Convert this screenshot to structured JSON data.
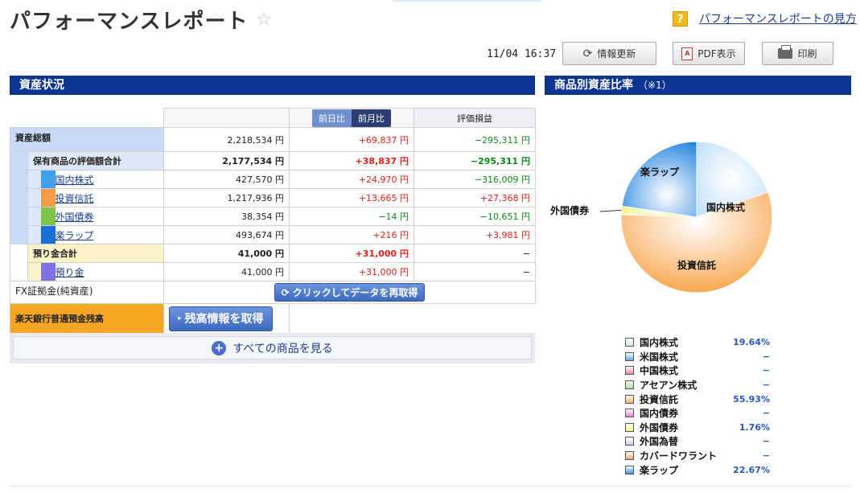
{
  "title": "パフォーマンスレポート",
  "help_link": "パフォーマンスレポートの見方",
  "toolbar": {
    "timestamp": "11/04 16:37",
    "refresh": "情報更新",
    "pdf": "PDF表示",
    "print": "印刷"
  },
  "section_assets": "資産状況",
  "section_ratio": "商品別資産比率",
  "section_ratio_note": "（※1）",
  "headers": {
    "prev_day": "前日比",
    "prev_month": "前月比",
    "pl": "評価損益"
  },
  "total": {
    "label": "資産総額",
    "value": "2,218,534 円",
    "change": "+69,837 円",
    "pl": "−295,311 円"
  },
  "holdings": {
    "label": "保有商品の評価額合計",
    "value": "2,177,534 円",
    "change": "+38,837 円",
    "pl": "−295,311 円"
  },
  "items": [
    {
      "name": "国内株式",
      "value": "427,570 円",
      "change": "+24,970 円",
      "pl": "−316,009 円",
      "color": "#3fa0ee",
      "change_color": "red",
      "pl_color": "green"
    },
    {
      "name": "投資信託",
      "value": "1,217,936 円",
      "change": "+13,665 円",
      "pl": "+27,368 円",
      "color": "#f79a45",
      "change_color": "red",
      "pl_color": "red"
    },
    {
      "name": "外国債券",
      "value": "38,354 円",
      "change": "−14 円",
      "pl": "−10,651 円",
      "color": "#7ec34a",
      "change_color": "green",
      "pl_color": "green"
    },
    {
      "name": "楽ラップ",
      "value": "493,674 円",
      "change": "+216 円",
      "pl": "+3,981 円",
      "color": "#1a6fd6",
      "change_color": "red",
      "pl_color": "red"
    }
  ],
  "deposits_total": {
    "label": "預り金合計",
    "value": "41,000 円",
    "change": "+31,000 円",
    "pl": "−"
  },
  "deposit": {
    "name": "預り金",
    "value": "41,000 円",
    "change": "+31,000 円",
    "pl": "−",
    "color": "#7e72e4"
  },
  "fx": {
    "label": "FX証拠金(純資産)",
    "button": "クリックしてデータを再取得"
  },
  "bank": {
    "label": "楽天銀行普通預金残高",
    "button": "残高情報を取得"
  },
  "see_all": "すべての商品を見る",
  "chart_data": {
    "type": "pie",
    "slices": [
      {
        "name": "国内株式",
        "value": 19.64,
        "color": "#cfe8fb"
      },
      {
        "name": "投資信託",
        "value": 55.93,
        "color": "#f8b060"
      },
      {
        "name": "外国債券",
        "value": 1.76,
        "color": "#f4f28a"
      },
      {
        "name": "楽ラップ",
        "value": 22.67,
        "color": "#3a92e0"
      }
    ],
    "labels": [
      "国内株式",
      "投資信託",
      "外国債券",
      "楽ラップ"
    ]
  },
  "legend": [
    {
      "name": "国内株式",
      "value": "19.64%",
      "color": "#cfe8fb"
    },
    {
      "name": "米国株式",
      "value": "−",
      "color": "#6aa3d8"
    },
    {
      "name": "中国株式",
      "value": "−",
      "color": "#f080a8"
    },
    {
      "name": "アセアン株式",
      "value": "−",
      "color": "#a8e08a"
    },
    {
      "name": "投資信託",
      "value": "55.93%",
      "color": "#f8b060"
    },
    {
      "name": "国内債券",
      "value": "−",
      "color": "#e680e0"
    },
    {
      "name": "外国債券",
      "value": "1.76%",
      "color": "#f4f28a"
    },
    {
      "name": "外国為替",
      "value": "−",
      "color": "#d8c0f0"
    },
    {
      "name": "カバードワラント",
      "value": "−",
      "color": "#f4a070"
    },
    {
      "name": "楽ラップ",
      "value": "22.67%",
      "color": "#3a92e0"
    }
  ]
}
